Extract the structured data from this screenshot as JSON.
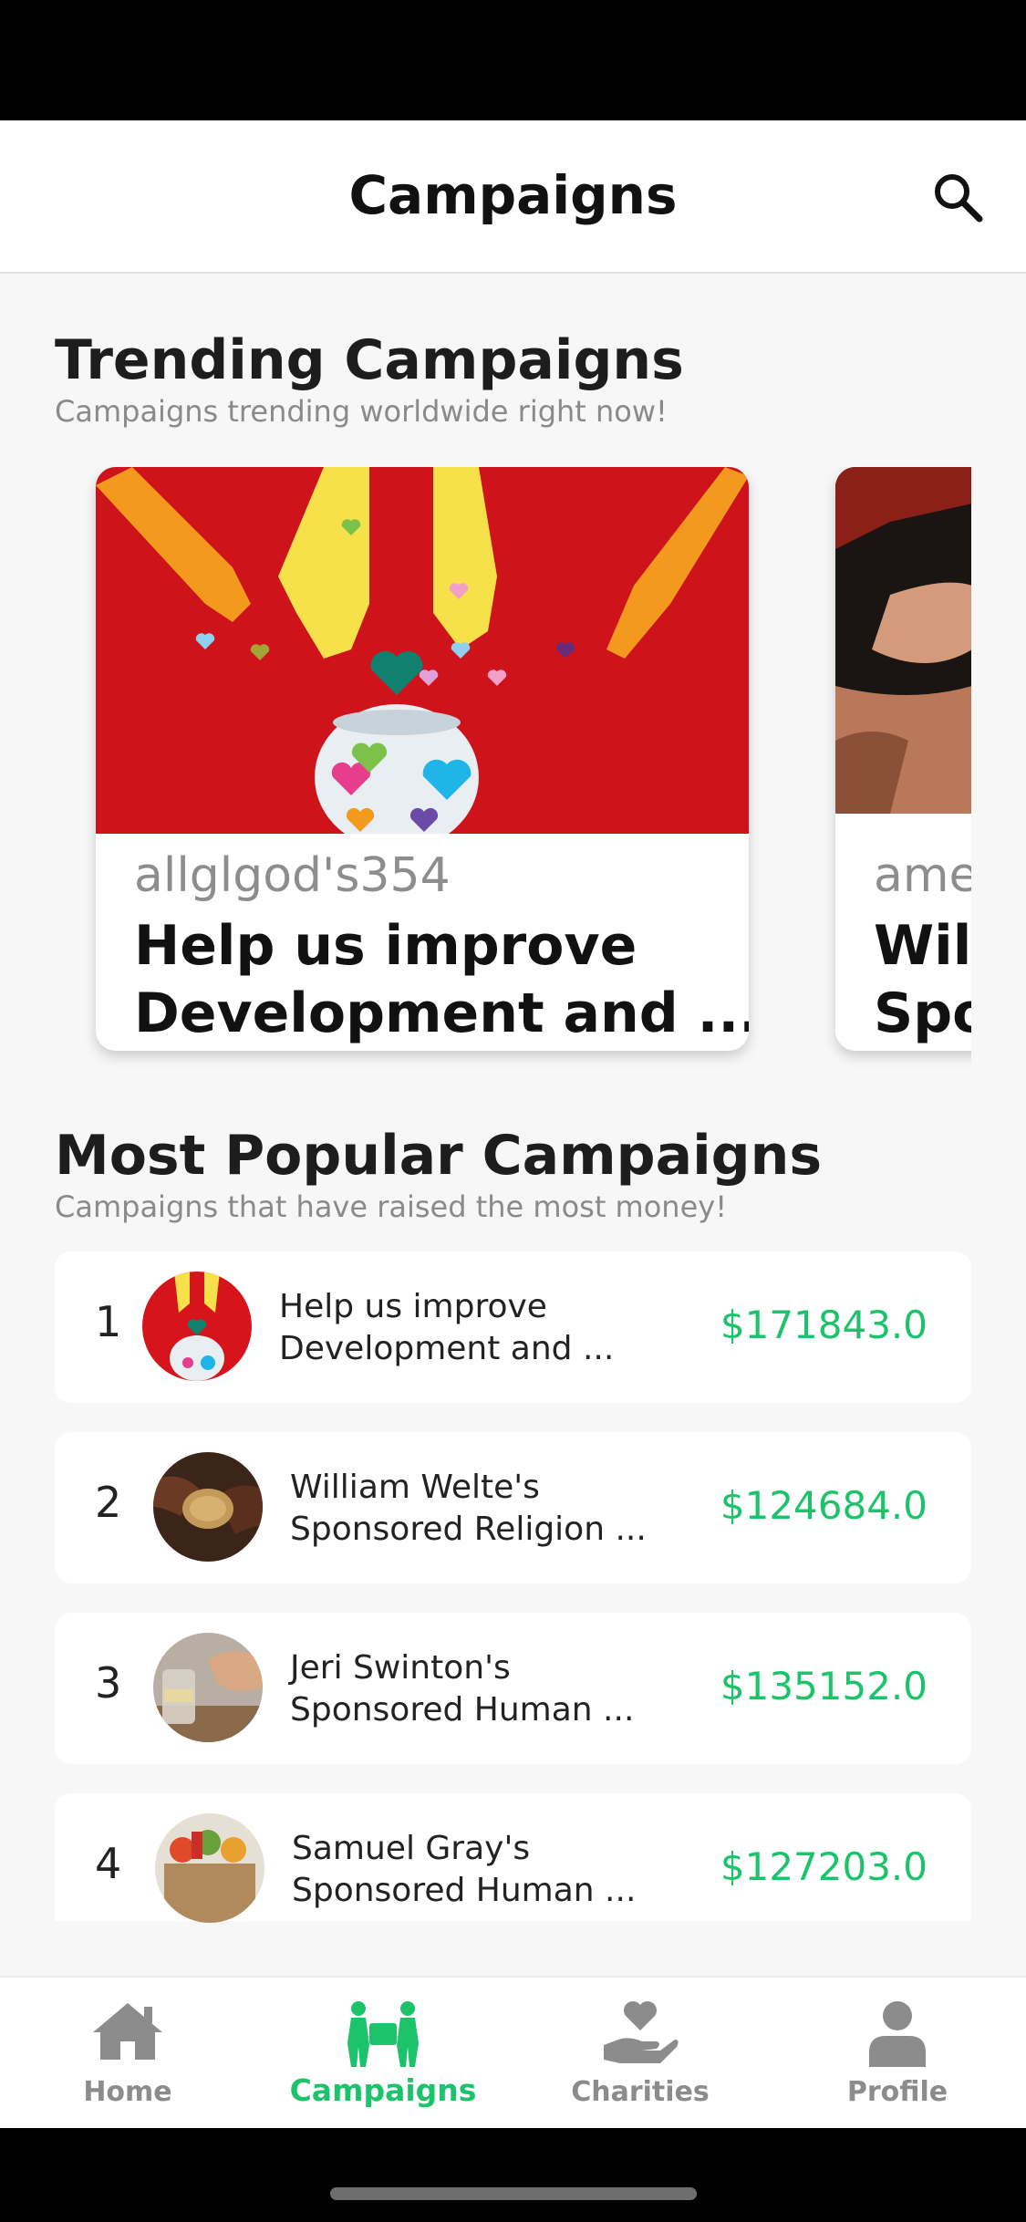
{
  "header": {
    "title": "Campaigns"
  },
  "trending": {
    "title": "Trending Campaigns",
    "subtitle": "Campaigns trending worldwide right now!",
    "cards": [
      {
        "author": "allglgod's354",
        "title_line1": "Help us improve",
        "title_line2": "Development and ..."
      },
      {
        "author": "ame",
        "title_line1": "Wil",
        "title_line2": "Spo"
      }
    ]
  },
  "popular": {
    "title": "Most Popular Campaigns",
    "subtitle": "Campaigns that have raised the most money!",
    "rows": [
      {
        "rank": "1",
        "line1": "Help us improve",
        "line2": "Development and ...",
        "amount": "$171843.0"
      },
      {
        "rank": "2",
        "line1": "William Welte's",
        "line2": "Sponsored Religion ...",
        "amount": "$124684.0"
      },
      {
        "rank": "3",
        "line1": "Jeri Swinton's",
        "line2": "Sponsored Human ...",
        "amount": "$135152.0"
      },
      {
        "rank": "4",
        "line1": "Samuel Gray's",
        "line2": "Sponsored Human ...",
        "amount": "$127203.0"
      }
    ]
  },
  "tabs": [
    {
      "label": "Home",
      "icon": "home-icon"
    },
    {
      "label": "Campaigns",
      "icon": "campaigns-icon"
    },
    {
      "label": "Charities",
      "icon": "charities-icon"
    },
    {
      "label": "Profile",
      "icon": "profile-icon"
    }
  ],
  "colors": {
    "accent": "#1cc36a",
    "inactive": "#8c8c8c",
    "card_red": "#d6141c"
  }
}
